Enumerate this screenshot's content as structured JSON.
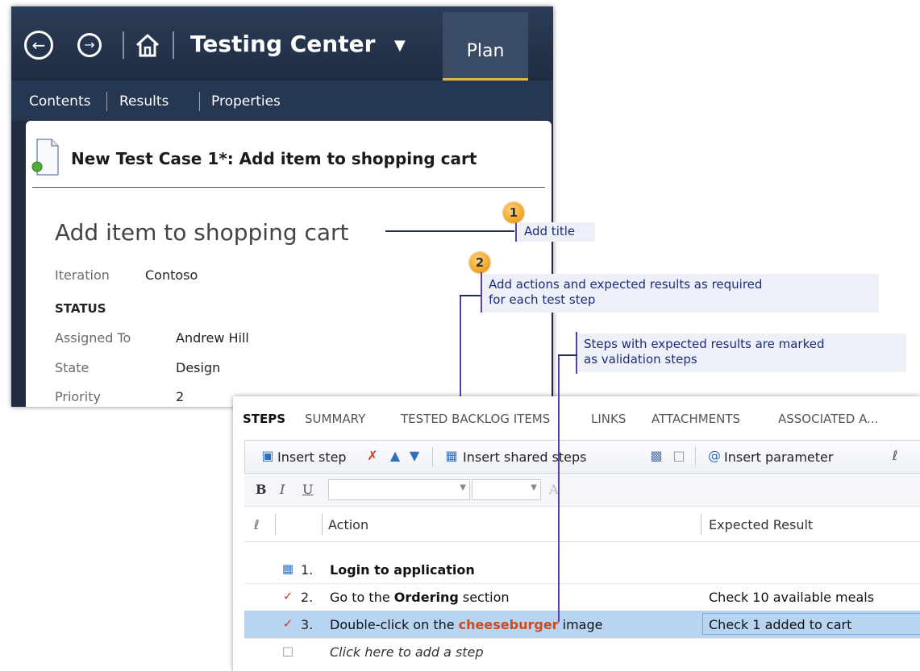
{
  "window": {
    "nav": {
      "back_icon": "back-arrow-icon",
      "forward_icon": "forward-arrow-icon",
      "home_icon": "home-icon"
    },
    "app_name": "Testing Center",
    "active_tab": "Plan",
    "subnav": [
      "Contents",
      "Results",
      "Properties"
    ],
    "card_title": "New Test Case 1*: Add item to shopping cart",
    "work_item": {
      "title": "Add item to shopping cart",
      "iteration_label": "Iteration",
      "iteration_value": "Contoso",
      "status_heading": "STATUS",
      "fields": [
        {
          "label": "Assigned To",
          "value": "Andrew Hill"
        },
        {
          "label": "State",
          "value": "Design"
        },
        {
          "label": "Priority",
          "value": "2"
        }
      ]
    }
  },
  "callouts": {
    "one": {
      "badge": "1",
      "text": "Add title"
    },
    "two": {
      "badge": "2",
      "line1": "Add actions and expected results as required",
      "line2": "for each test step"
    },
    "three": {
      "line1": "Steps with expected results are marked",
      "line2": "as validation steps"
    }
  },
  "steps_panel": {
    "tabs": [
      "STEPS",
      "SUMMARY",
      "TESTED BACKLOG ITEMS",
      "LINKS",
      "ATTACHMENTS",
      "ASSOCIATED A..."
    ],
    "toolbar": {
      "insert_step": "Insert step",
      "insert_shared": "Insert shared steps",
      "insert_param": "Insert parameter"
    },
    "format": {
      "bold": "B",
      "italic": "I",
      "underline": "U"
    },
    "columns": {
      "action": "Action",
      "expected": "Expected Result"
    },
    "rows": [
      {
        "num": "1.",
        "action": "Login to application",
        "expected": "",
        "icon": "shared-steps-icon"
      },
      {
        "num": "2.",
        "action_pre": "Go to the ",
        "action_bold": "Ordering",
        "action_post": " section",
        "expected": "Check 10 available meals",
        "icon": "validation-step-icon"
      },
      {
        "num": "3.",
        "action_pre": "Double-click on the ",
        "action_bold": "cheeseburger",
        "action_post": " image",
        "expected": "Check 1 added to cart",
        "icon": "validation-step-icon",
        "selected": true
      }
    ],
    "add_step_prompt": "Click here to add a step"
  }
}
